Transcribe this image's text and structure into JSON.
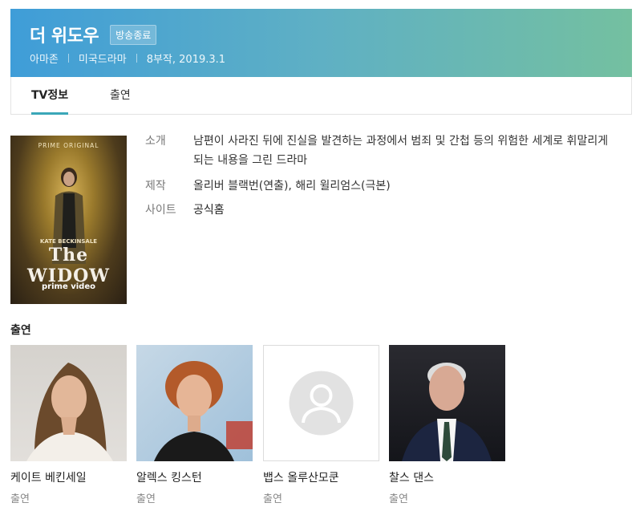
{
  "header": {
    "title": "더 위도우",
    "status": "방송종료",
    "meta": [
      "아마존",
      "미국드라마",
      "8부작, 2019.3.1"
    ]
  },
  "tabs": [
    {
      "label": "TV정보",
      "active": true
    },
    {
      "label": "출연",
      "active": false
    }
  ],
  "poster": {
    "top_text": "PRIME ORIGINAL",
    "actor_text": "KATE BECKINSALE",
    "title_text": "The WIDOW",
    "brand_text": "prime video"
  },
  "info": {
    "intro_label": "소개",
    "intro_value": "남편이 사라진 뒤에 진실을 발견하는 과정에서 범죄 및 간첩 등의 위험한 세계로 휘말리게 되는 내용을 그린 드라마",
    "production_label": "제작",
    "production_value": "올리버 블랙번(연출), 해리 윌리엄스(극본)",
    "site_label": "사이트",
    "site_value": "공식홈"
  },
  "cast": {
    "heading": "출연",
    "members": [
      {
        "name": "케이트 베킨세일",
        "role": "출연"
      },
      {
        "name": "알렉스 킹스턴",
        "role": "출연"
      },
      {
        "name": "뱁스 올루산모쿤",
        "role": "출연"
      },
      {
        "name": "찰스 댄스",
        "role": "출연"
      }
    ]
  },
  "colors": {
    "header_gradient_start": "#3f9dd8",
    "header_gradient_end": "#74c0a0",
    "tab_underline": "#3aa7b8"
  }
}
